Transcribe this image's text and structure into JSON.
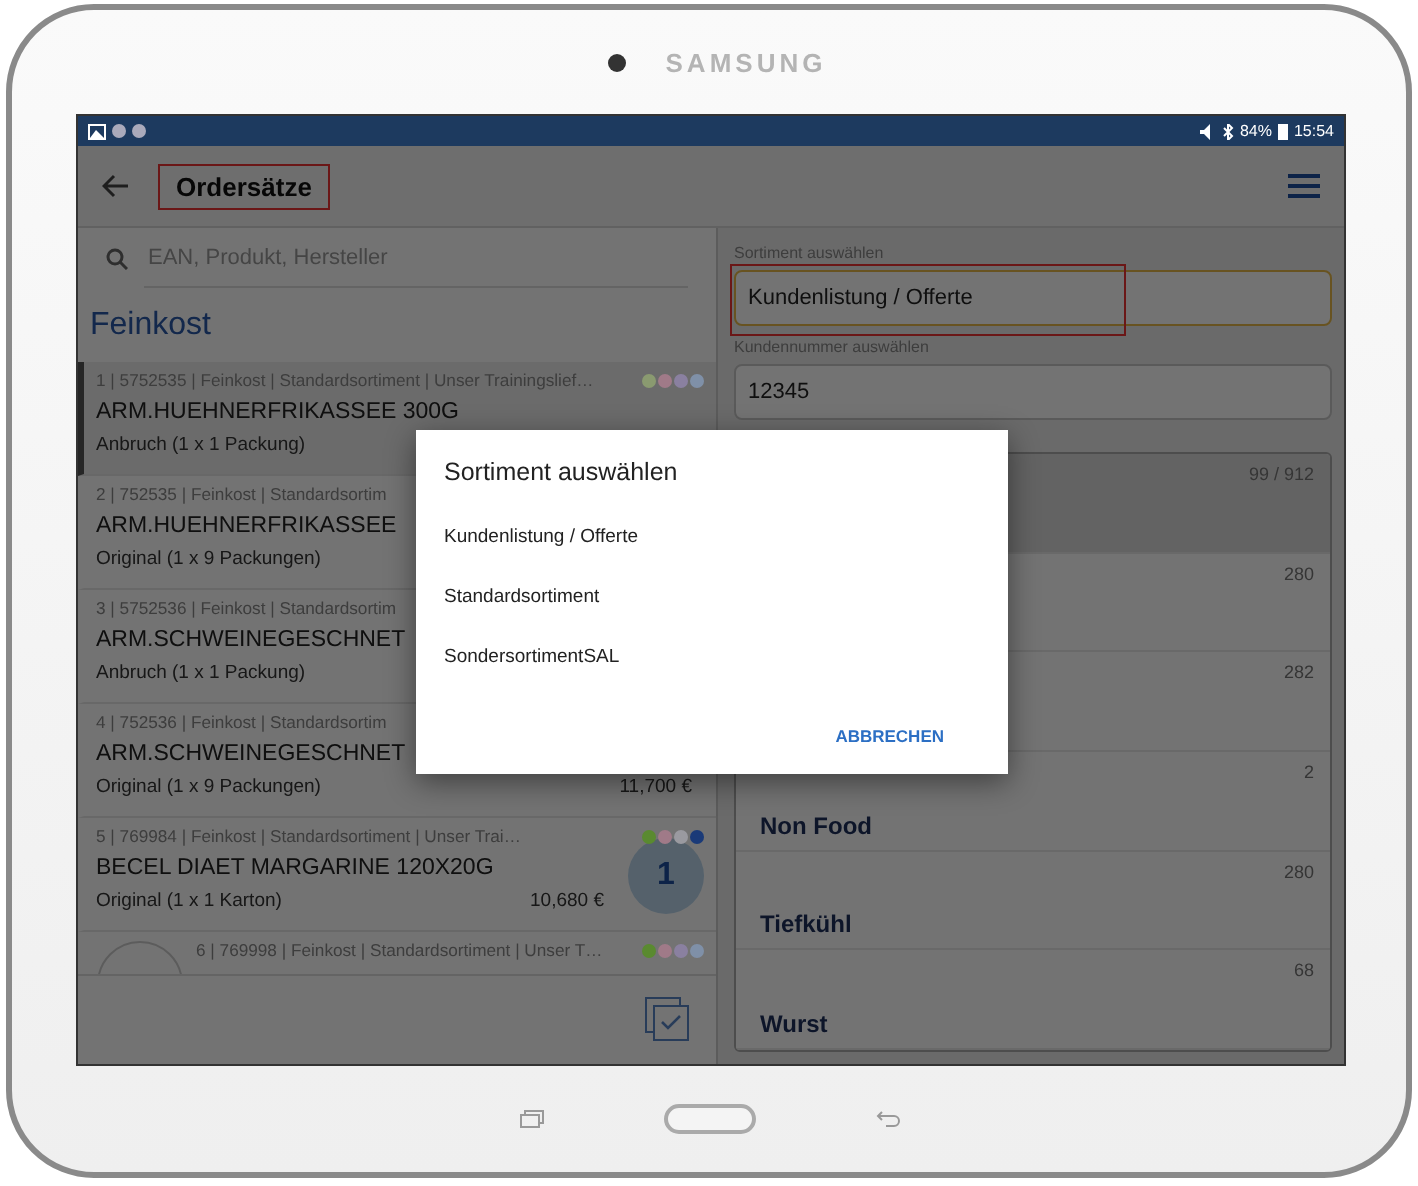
{
  "device": {
    "brand": "SAMSUNG"
  },
  "status_bar": {
    "battery": "84%",
    "time": "15:54"
  },
  "app_bar": {
    "title": "Ordersätze"
  },
  "search": {
    "placeholder": "EAN, Produkt, Hersteller"
  },
  "section_title": "Feinkost",
  "products": [
    {
      "meta": "1 | 5752535 | Feinkost | Standardsortiment | Unser Trainingslief…",
      "name": "ARM.HUEHNERFRIKASSEE 300G",
      "packaging": "Anbruch (1 x 1 Packung)",
      "selected": true,
      "has_image": false,
      "dots": [
        {
          "color": "#8a9a70"
        },
        {
          "color": "#a07a88"
        },
        {
          "color": "#8a80a0"
        },
        {
          "color": "#7f90a8"
        }
      ]
    },
    {
      "meta": "2 | 752535 | Feinkost | Standardsortim",
      "name": "ARM.HUEHNERFRIKASSEE",
      "packaging": "Original (1 x 9 Packungen)",
      "selected": false,
      "has_image": false
    },
    {
      "meta": "3 | 5752536 | Feinkost | Standardsortim",
      "name": "ARM.SCHWEINEGESCHNET",
      "packaging": "Anbruch (1 x 1 Packung)",
      "selected": false,
      "has_image": false
    },
    {
      "meta": "4 | 752536 | Feinkost | Standardsortim",
      "name": "ARM.SCHWEINEGESCHNET",
      "packaging": "Original (1 x 9 Packungen)",
      "price": "11,700 €",
      "selected": false,
      "has_image": false
    },
    {
      "meta": "5 | 769984 | Feinkost | Standardsortiment | Unser Trai…",
      "name": "BECEL DIAET MARGARINE 120X20G",
      "packaging": "Original (1 x 1 Karton)",
      "price": "10,680 €",
      "badge": "1",
      "selected": false,
      "has_image": false,
      "dots": [
        {
          "color": "#5a8a30"
        },
        {
          "color": "#a07a88"
        },
        {
          "color": "#9a9aa0"
        },
        {
          "color": "#1a3a78"
        }
      ]
    },
    {
      "meta": "6 | 769998 | Feinkost | Standardsortiment | Unser T…",
      "selected": false,
      "has_image": true,
      "dots": [
        {
          "color": "#5a8a30"
        },
        {
          "color": "#a07a88"
        },
        {
          "color": "#8a80a0"
        },
        {
          "color": "#7f90a8"
        }
      ]
    }
  ],
  "filters": {
    "sortiment": {
      "label": "Sortiment auswählen",
      "value": "Kundenlistung / Offerte"
    },
    "customer": {
      "label": "Kundennummer auswählen",
      "value": "12345"
    }
  },
  "categories": [
    {
      "count": "99 / 912",
      "selected": true
    },
    {
      "count": "280",
      "selected": false
    },
    {
      "count": "282",
      "selected": false
    },
    {
      "name": "Non Food",
      "count": "2",
      "selected": false
    },
    {
      "name": "Tiefkühl",
      "count": "280",
      "selected": false
    },
    {
      "name": "Wurst",
      "count": "68",
      "selected": false
    }
  ],
  "dialog": {
    "title": "Sortiment auswählen",
    "options": [
      "Kundenlistung / Offerte",
      "Standardsortiment",
      "SondersortimentSAL"
    ],
    "cancel": "ABBRECHEN"
  }
}
